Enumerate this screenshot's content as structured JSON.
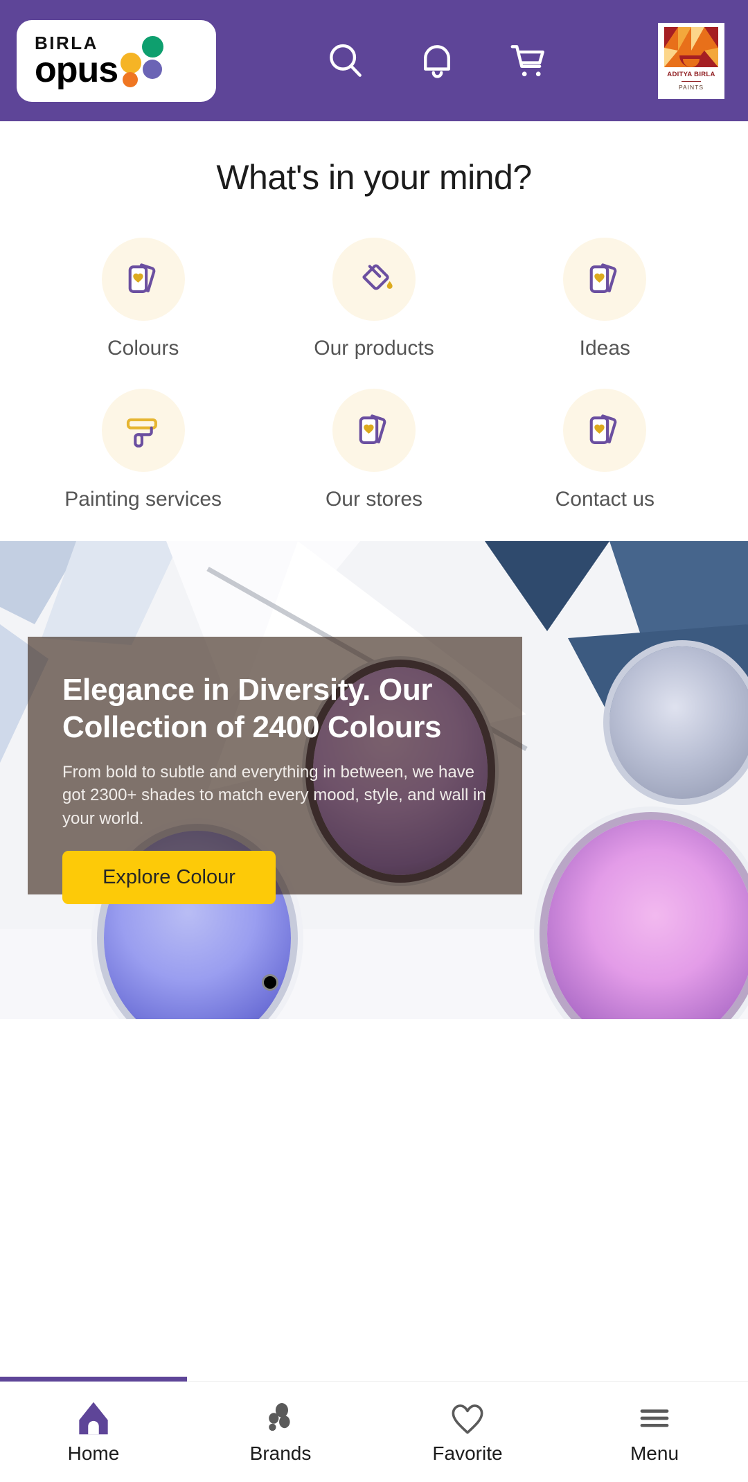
{
  "brand": {
    "purple": "#5E4598",
    "yellow": "#FDCA08",
    "cream": "#FDF6E6",
    "logo_line1": "BIRLA",
    "logo_line2": "opus",
    "partner_name": "ADITYA BIRLA",
    "partner_sub": "PAINTS"
  },
  "header": {
    "icons": [
      {
        "name": "search-icon",
        "label": "Search"
      },
      {
        "name": "notification-bell-icon",
        "label": "Notifications"
      },
      {
        "name": "shopping-cart-icon",
        "label": "Cart"
      }
    ]
  },
  "quick_links": {
    "title": "What's in your mind?",
    "items": [
      {
        "label": "Colours",
        "icon": "colour-swatch-cards-icon"
      },
      {
        "label": "Our products",
        "icon": "paint-bucket-icon"
      },
      {
        "label": "Ideas",
        "icon": "colour-swatch-cards-icon"
      },
      {
        "label": "Painting services",
        "icon": "paint-roller-icon"
      },
      {
        "label": "Our stores",
        "icon": "colour-swatch-cards-icon"
      },
      {
        "label": "Contact us",
        "icon": "colour-swatch-cards-icon"
      }
    ]
  },
  "hero": {
    "heading": "Elegance in Diversity. Our Collection of 2400 Colours",
    "body": "From bold to subtle and everything in between, we have got 2300+ shades to match every mood, style, and wall in your world.",
    "cta_label": "Explore Colour"
  },
  "bottom_nav": {
    "active": "Home",
    "items": [
      {
        "label": "Home",
        "icon": "home-icon",
        "active": true
      },
      {
        "label": "Brands",
        "icon": "brands-dots-icon",
        "active": false
      },
      {
        "label": "Favorite",
        "icon": "heart-icon",
        "active": false
      },
      {
        "label": "Menu",
        "icon": "hamburger-menu-icon",
        "active": false
      }
    ]
  }
}
